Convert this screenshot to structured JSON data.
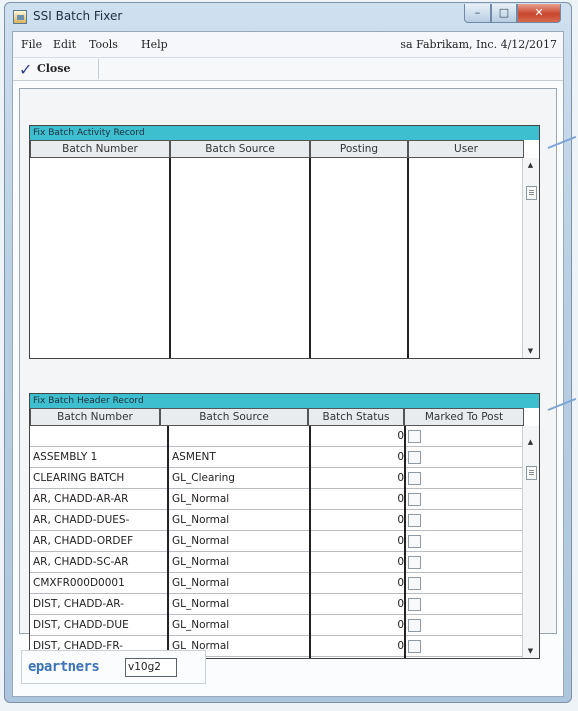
{
  "window": {
    "title": "SSI Batch Fixer",
    "controls": {
      "minimize": "–",
      "maximize": "□",
      "close": "✕"
    }
  },
  "menubar": {
    "items": [
      "File",
      "Edit",
      "Tools",
      "Help"
    ],
    "company_info": "sa  Fabrikam, Inc.  4/12/2017"
  },
  "toolbar": {
    "close_label": "Close",
    "close_icon": "checkmark-icon"
  },
  "activity": {
    "title": "Fix Batch Activity Record",
    "columns": [
      "Batch Number",
      "Batch Source",
      "Posting",
      "User"
    ]
  },
  "header": {
    "title": "Fix Batch Header Record",
    "columns": [
      "Batch Number",
      "Batch Source",
      "Batch Status",
      "Marked To Post"
    ],
    "rows": [
      {
        "batch_number": "",
        "batch_source": "",
        "status": "0"
      },
      {
        "batch_number": "ASSEMBLY 1",
        "batch_source": "ASMENT",
        "status": "0"
      },
      {
        "batch_number": "CLEARING BATCH",
        "batch_source": "GL_Clearing",
        "status": "0"
      },
      {
        "batch_number": "AR, CHADD-AR-AR",
        "batch_source": "GL_Normal",
        "status": "0"
      },
      {
        "batch_number": "AR, CHADD-DUES-",
        "batch_source": "GL_Normal",
        "status": "0"
      },
      {
        "batch_number": "AR, CHADD-ORDEF",
        "batch_source": "GL_Normal",
        "status": "0"
      },
      {
        "batch_number": "AR, CHADD-SC-AR",
        "batch_source": "GL_Normal",
        "status": "0"
      },
      {
        "batch_number": "CMXFR000D0001",
        "batch_source": "GL_Normal",
        "status": "0"
      },
      {
        "batch_number": "DIST, CHADD-AR-",
        "batch_source": "GL_Normal",
        "status": "0"
      },
      {
        "batch_number": "DIST, CHADD-DUE",
        "batch_source": "GL_Normal",
        "status": "0"
      },
      {
        "batch_number": "DIST, CHADD-FR-",
        "batch_source": "GL_Normal",
        "status": "0"
      }
    ]
  },
  "footer": {
    "logo": "epartners",
    "version": "v10g2"
  },
  "colors": {
    "section_header": "#3dbfd0",
    "close_button": "#c8452c",
    "callout": "#7da6d6"
  }
}
